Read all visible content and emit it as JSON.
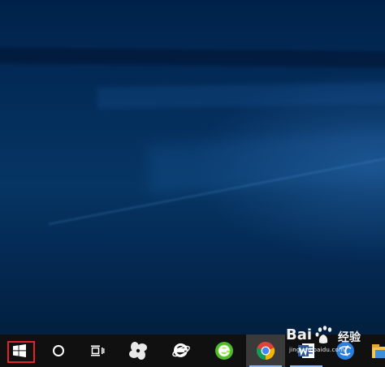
{
  "desktop": {
    "wallpaper": "windows-10-blue-light",
    "colors": {
      "dark": "#00224a",
      "mid": "#063563",
      "light": "#3c82cd"
    }
  },
  "taskbar": {
    "background": "#101010",
    "start_button": {
      "icon": "windows-logo-icon",
      "highlight_color": "#e0242d"
    },
    "cortana_button": {
      "icon": "cortana-circle-icon"
    },
    "task_view_button": {
      "icon": "task-view-icon"
    },
    "pinned_apps": [
      {
        "name": "app-1",
        "icon": "pinwheel-icon",
        "running": false,
        "active": false
      },
      {
        "name": "app-2",
        "icon": "internet-explorer-icon",
        "running": false,
        "active": false
      },
      {
        "name": "app-3",
        "icon": "green-browser-icon",
        "running": false,
        "active": false
      },
      {
        "name": "app-4",
        "icon": "chrome-icon",
        "running": true,
        "active": true
      },
      {
        "name": "app-5",
        "icon": "word-icon",
        "running": true,
        "active": false
      },
      {
        "name": "app-6",
        "icon": "blue-globe-icon",
        "running": false,
        "active": false
      },
      {
        "name": "app-7",
        "icon": "file-explorer-icon",
        "running": false,
        "active": false
      }
    ]
  },
  "watermark": {
    "brand": "经验",
    "sub": "jingyan.baidu.com"
  }
}
